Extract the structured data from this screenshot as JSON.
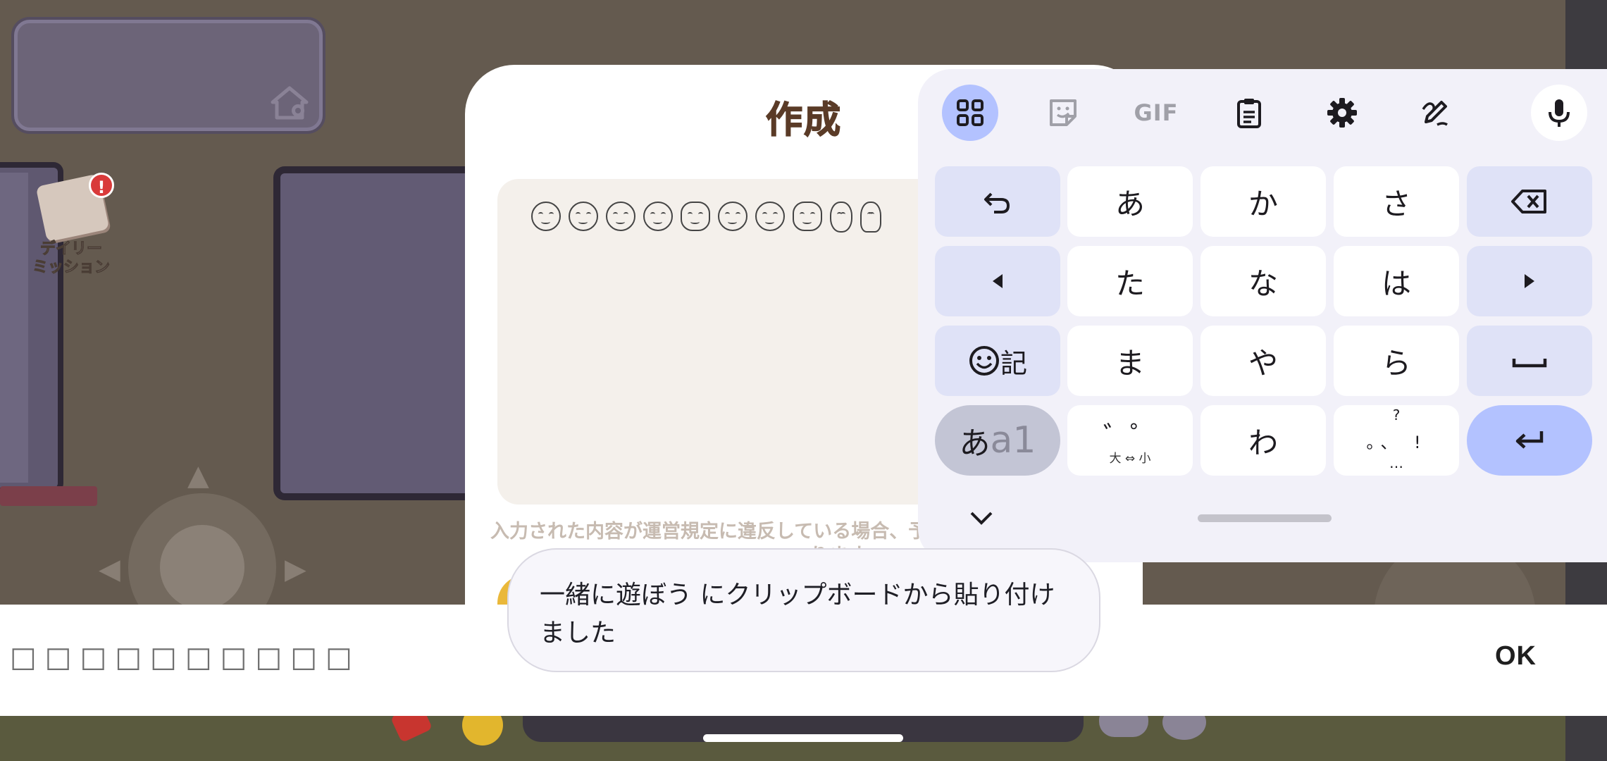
{
  "game": {
    "daily_mission_label": "デイリー\nミッション",
    "daily_mission_alert": "!"
  },
  "dialog": {
    "title": "作成",
    "notice_line1": "入力された内容が運営規定に違反している場合、予告",
    "notice_line2": "ります"
  },
  "keyboard": {
    "toolbar": [
      {
        "name": "apps-grid-icon"
      },
      {
        "name": "sticker-icon"
      },
      {
        "name": "gif-button",
        "label": "GIF"
      },
      {
        "name": "clipboard-icon"
      },
      {
        "name": "settings-gear-icon"
      },
      {
        "name": "handwriting-pen-icon"
      },
      {
        "name": "microphone-icon"
      }
    ],
    "keys": {
      "a": "あ",
      "ka": "か",
      "sa": "さ",
      "ta": "た",
      "na": "な",
      "ha": "は",
      "ma": "ま",
      "ya": "や",
      "ra": "ら",
      "wa": "わ",
      "emoji_kigou": "記",
      "mode_kana": "あ",
      "mode_alpha": "a1",
      "dakuten": "゛゜",
      "dakuten_sub": "大 ⇔ 小",
      "punct_top": "?",
      "punct_mid": "。、 !",
      "punct_bot": "…"
    },
    "colors": {
      "accent": "#b3c2ff",
      "function_key": "#dfe2f7",
      "background": "#f2f1f9"
    }
  },
  "input": {
    "value": "□□□□□□□□□□",
    "ok_label": "OK"
  },
  "toast": {
    "message": "一緒に遊ぼう にクリップボードから貼り付けました"
  }
}
